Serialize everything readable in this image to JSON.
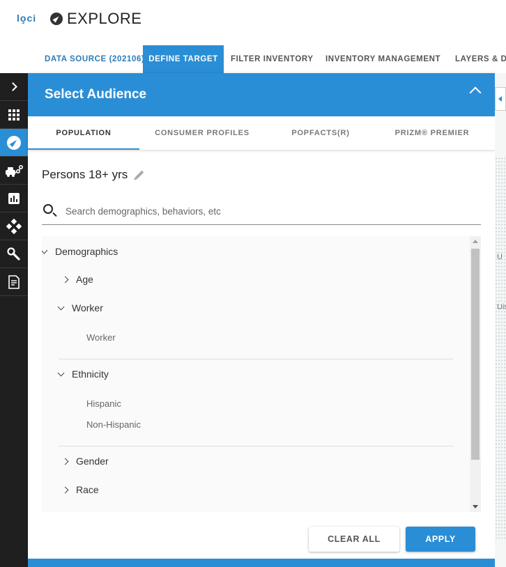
{
  "app": {
    "logo": "lo̧ci",
    "page_title": "EXPLORE"
  },
  "nav": {
    "data_source": "DATA SOURCE (202106)",
    "define_target": "DEFINE TARGET",
    "filter_inventory": "FILTER INVENTORY",
    "inventory_management": "INVENTORY MANAGEMENT",
    "layers": "LAYERS & DE"
  },
  "rail": {
    "items": [
      "chevron-right-icon",
      "grid-icon",
      "compass-icon",
      "vehicles-icon",
      "bar-chart-icon",
      "diamond-network-icon",
      "wrench-icon",
      "document-icon"
    ],
    "active_index": 2
  },
  "panel": {
    "title": "Select Audience",
    "tabs": [
      "POPULATION",
      "CONSUMER PROFILES",
      "POPFACTS(R)",
      "PRIZM® PREMIER"
    ],
    "active_tab": "POPULATION",
    "audience_name": "Persons 18+ yrs",
    "search": {
      "placeholder": "Search demographics, behaviors, etc",
      "value": ""
    },
    "tree": {
      "root": {
        "label": "Demographics",
        "expanded": true
      },
      "groups": [
        {
          "label": "Age",
          "expanded": false
        },
        {
          "label": "Worker",
          "expanded": true,
          "children": [
            "Worker"
          ]
        },
        {
          "label": "Ethnicity",
          "expanded": true,
          "children": [
            "Hispanic",
            "Non-Hispanic"
          ]
        },
        {
          "label": "Gender",
          "expanded": false
        },
        {
          "label": "Race",
          "expanded": false
        }
      ]
    },
    "buttons": {
      "clear_all": "CLEAR ALL",
      "apply": "APPLY"
    }
  },
  "colors": {
    "accent": "#2a8ed6",
    "rail": "#1f1f1f",
    "logo": "#2b7bb8"
  },
  "map": {
    "labels": [
      "U",
      "Uis"
    ]
  }
}
